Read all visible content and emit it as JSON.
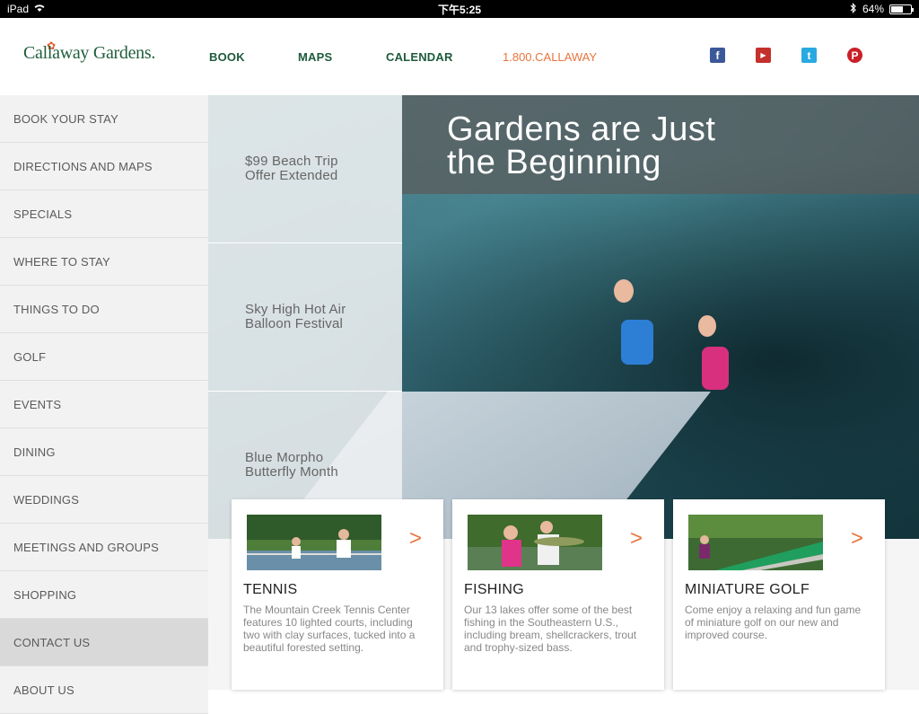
{
  "status": {
    "device": "iPad",
    "time": "下午5:25",
    "battery": "64%",
    "battery_level": 0.64
  },
  "header": {
    "logo_text": "Callaway Gardens.",
    "nav": [
      {
        "label": "BOOK"
      },
      {
        "label": "MAPS"
      },
      {
        "label": "CALENDAR"
      }
    ],
    "phone": "1.800.CALLAWAY",
    "social": [
      {
        "name": "facebook-icon",
        "glyph": "f",
        "color": "#3b5998"
      },
      {
        "name": "youtube-icon",
        "glyph": "▶",
        "color": "#c4302b"
      },
      {
        "name": "twitter-icon",
        "glyph": "t",
        "color": "#29a9e1"
      },
      {
        "name": "pinterest-icon",
        "glyph": "P",
        "color": "#cb2027"
      }
    ]
  },
  "sidebar": {
    "items": [
      {
        "label": "BOOK YOUR STAY"
      },
      {
        "label": "DIRECTIONS AND MAPS"
      },
      {
        "label": "SPECIALS"
      },
      {
        "label": "WHERE TO STAY"
      },
      {
        "label": "THINGS TO DO"
      },
      {
        "label": "GOLF"
      },
      {
        "label": "EVENTS"
      },
      {
        "label": "DINING"
      },
      {
        "label": "WEDDINGS"
      },
      {
        "label": "MEETINGS AND GROUPS"
      },
      {
        "label": "SHOPPING"
      },
      {
        "label": "CONTACT US"
      },
      {
        "label": "ABOUT US"
      }
    ]
  },
  "hero": {
    "headline": "Gardens are Just\nthe Beginning",
    "specials": [
      {
        "label": "$99 Beach Trip\nOffer Extended"
      },
      {
        "label": "Sky High Hot Air\nBalloon Festival"
      },
      {
        "label": "Blue Morpho\nButterfly Month"
      }
    ]
  },
  "cards": [
    {
      "title": "TENNIS",
      "arrow": ">",
      "desc": "The Mountain Creek Tennis Center features 10 lighted courts, including two with clay surfaces, tucked into a beautiful forested setting."
    },
    {
      "title": "FISHING",
      "arrow": ">",
      "desc": "Our 13 lakes offer some of the best fishing in the Southeastern U.S., including bream, shellcrackers, trout and trophy-sized bass."
    },
    {
      "title": "MINIATURE GOLF",
      "arrow": ">",
      "desc": "Come enjoy a relaxing and fun game of miniature golf on our new and improved course."
    }
  ],
  "colors": {
    "brand_green": "#1e5a3b",
    "accent_orange": "#e8743e"
  }
}
